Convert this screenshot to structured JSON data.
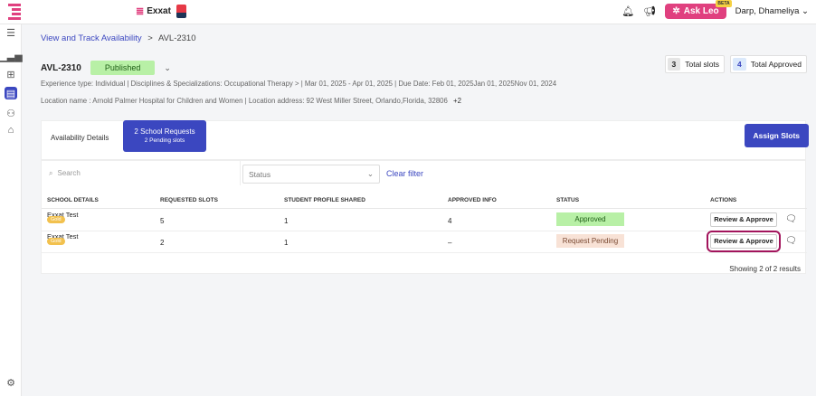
{
  "header": {
    "brand": "Exxat",
    "ask_leo": "Ask Leo",
    "beta": "BETA",
    "user": "Darp, Dhameliya"
  },
  "breadcrumb": {
    "link": "View and Track Availability",
    "sep": ">",
    "current": "AVL-2310"
  },
  "record": {
    "id": "AVL-2310",
    "status": "Published",
    "total_slots": "3",
    "total_slots_label": "Total slots",
    "total_approved": "4",
    "total_approved_label": "Total Approved",
    "meta1": "Experience type: Individual  |  Disciplines & Specializations: Occupational Therapy  >  |  Mar 01, 2025 - Apr 01, 2025  |  Due Date: Feb 01, 2025Jan 01, 2025Nov 01, 2024",
    "meta2": "Location name : Arnold Palmer Hospital for Children and Women  |  Location address: 92 West Miller Street, Orlando,Florida, 32806",
    "meta2_more": "+2"
  },
  "tabs": {
    "availability": "Availability Details",
    "requests_l1": "2 School Requests",
    "requests_l2": "2 Pending slots"
  },
  "assign": "Assign Slots",
  "filters": {
    "search_placeholder": "Search",
    "status": "Status",
    "clear": "Clear filter"
  },
  "columns": [
    "SCHOOL DETAILS",
    "REQUESTED SLOTS",
    "STUDENT PROFILE SHARED",
    "APPROVED INFO",
    "STATUS",
    "ACTIONS"
  ],
  "rows": [
    {
      "school": "Exxat Test",
      "tier": "Gold",
      "requested": "5",
      "shared": "1",
      "approved": "4",
      "status": "Approved",
      "action": "Review & Approve"
    },
    {
      "school": "Exxat Test",
      "tier": "Gold",
      "requested": "2",
      "shared": "1",
      "approved": "–",
      "status": "Request Pending",
      "action": "Review & Approve"
    }
  ],
  "showing": "Showing 2 of 2 results"
}
